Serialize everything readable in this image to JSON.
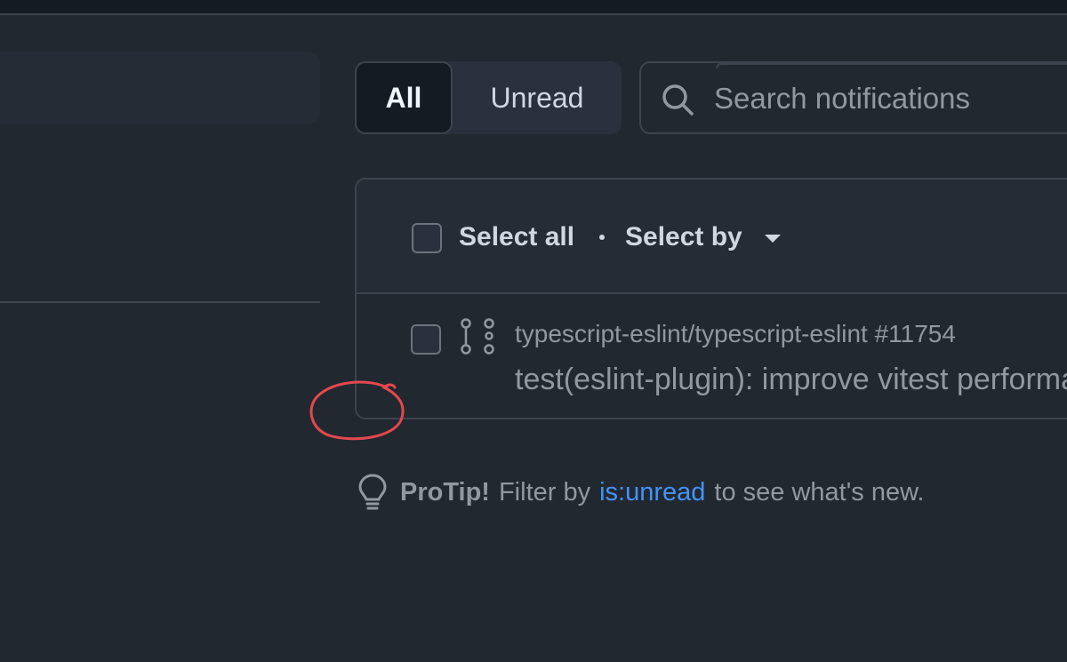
{
  "filter": {
    "all_label": "All",
    "unread_label": "Unread"
  },
  "search": {
    "placeholder": "Search notifications",
    "icon": "search-icon"
  },
  "list_header": {
    "select_all": "Select all",
    "separator": "·",
    "select_by": "Select by"
  },
  "notification": {
    "repo": "typescript-eslint/typescript-eslint #11754",
    "title": "test(eslint-plugin): improve vitest performance",
    "icon": "pull-request-icon"
  },
  "protip": {
    "label": "ProTip!",
    "before": "Filter by",
    "link": "is:unread",
    "after": "to see what's new."
  },
  "colors": {
    "background": "#212830",
    "border": "#3d444d",
    "link": "#4493f8",
    "annotation": "#e5484d"
  }
}
